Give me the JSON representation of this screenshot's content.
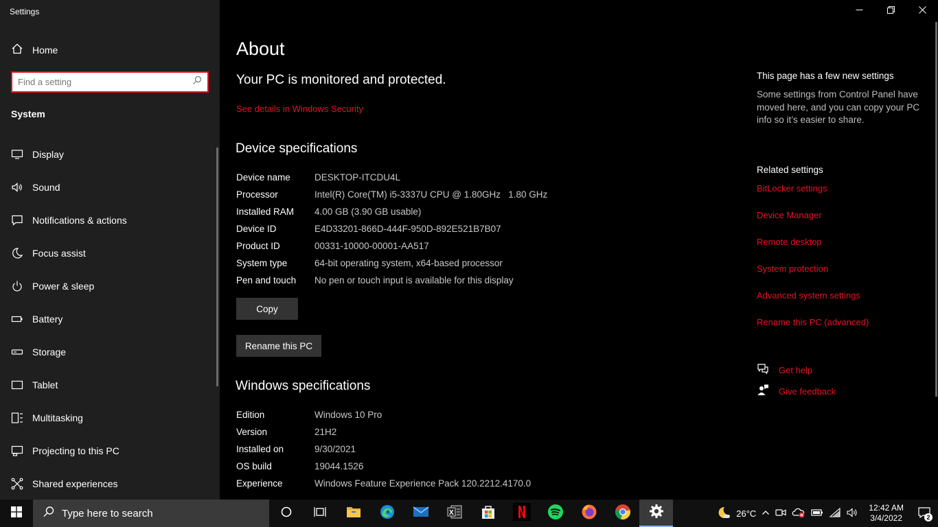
{
  "window": {
    "title": "Settings"
  },
  "sidebar": {
    "home_label": "Home",
    "search_placeholder": "Find a setting",
    "section": "System",
    "items": [
      {
        "label": "Display",
        "icon": "monitor-icon"
      },
      {
        "label": "Sound",
        "icon": "speaker-icon"
      },
      {
        "label": "Notifications & actions",
        "icon": "notification-icon"
      },
      {
        "label": "Focus assist",
        "icon": "moon-icon"
      },
      {
        "label": "Power & sleep",
        "icon": "power-icon"
      },
      {
        "label": "Battery",
        "icon": "battery-icon"
      },
      {
        "label": "Storage",
        "icon": "storage-icon"
      },
      {
        "label": "Tablet",
        "icon": "tablet-icon"
      },
      {
        "label": "Multitasking",
        "icon": "multitasking-icon"
      },
      {
        "label": "Projecting to this PC",
        "icon": "projecting-icon"
      },
      {
        "label": "Shared experiences",
        "icon": "shared-experiences-icon"
      }
    ]
  },
  "main": {
    "title": "About",
    "protection_status": "Your PC is monitored and protected.",
    "security_link": "See details in Windows Security",
    "device_specs": {
      "heading": "Device specifications",
      "rows": [
        {
          "key": "Device name",
          "value": "DESKTOP-ITCDU4L"
        },
        {
          "key": "Processor",
          "value": "Intel(R) Core(TM) i5-3337U CPU @ 1.80GHz   1.80 GHz"
        },
        {
          "key": "Installed RAM",
          "value": "4.00 GB (3.90 GB usable)"
        },
        {
          "key": "Device ID",
          "value": "E4D33201-866D-444F-950D-892E521B7B07"
        },
        {
          "key": "Product ID",
          "value": "00331-10000-00001-AA517"
        },
        {
          "key": "System type",
          "value": "64-bit operating system, x64-based processor"
        },
        {
          "key": "Pen and touch",
          "value": "No pen or touch input is available for this display"
        }
      ],
      "copy_button": "Copy",
      "rename_button": "Rename this PC"
    },
    "windows_specs": {
      "heading": "Windows specifications",
      "rows": [
        {
          "key": "Edition",
          "value": "Windows 10 Pro"
        },
        {
          "key": "Version",
          "value": "21H2"
        },
        {
          "key": "Installed on",
          "value": "9/30/2021"
        },
        {
          "key": "OS build",
          "value": "19044.1526"
        },
        {
          "key": "Experience",
          "value": "Windows Feature Experience Pack 120.2212.4170.0"
        }
      ]
    }
  },
  "right": {
    "new_settings_heading": "This page has a few new settings",
    "new_settings_body": "Some settings from Control Panel have moved here, and you can copy your PC info so it’s easier to share.",
    "related_heading": "Related settings",
    "related_links": [
      "BitLocker settings",
      "Device Manager",
      "Remote desktop",
      "System protection",
      "Advanced system settings",
      "Rename this PC (advanced)"
    ],
    "get_help": "Get help",
    "give_feedback": "Give feedback"
  },
  "taskbar": {
    "search_placeholder": "Type here to search",
    "pinned_apps": [
      "cortana-icon",
      "task-view-icon",
      "file-explorer-icon",
      "edge-icon",
      "mail-icon",
      "excel-icon",
      "microsoft-store-icon",
      "netflix-icon",
      "spotify-icon",
      "firefox-icon",
      "chrome-icon",
      "settings-icon"
    ],
    "weather_temp": "26°C",
    "time": "12:42 AM",
    "date": "3/4/2022",
    "notification_count": "2"
  },
  "colors": {
    "accent": "#e81123",
    "sidebar_bg": "#1f1f1f",
    "main_bg": "#000000",
    "taskbar_bg": "#101010"
  }
}
